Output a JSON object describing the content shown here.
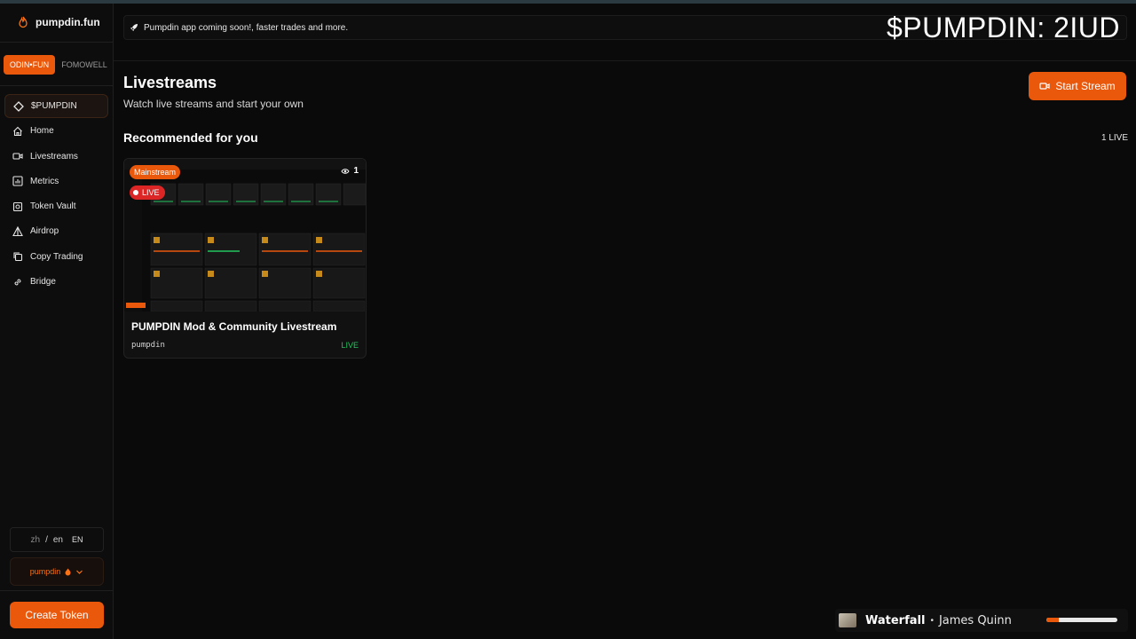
{
  "brand": {
    "name": "pumpdin.fun"
  },
  "platform": {
    "tabs": [
      "ODIN•FUN",
      "FOMOWELL"
    ],
    "active": 0
  },
  "nav": {
    "items": [
      {
        "label": "$PUMPDIN",
        "icon": "diamond-icon",
        "active": true
      },
      {
        "label": "Home",
        "icon": "home-icon"
      },
      {
        "label": "Livestreams",
        "icon": "video-icon"
      },
      {
        "label": "Metrics",
        "icon": "chart-icon"
      },
      {
        "label": "Token Vault",
        "icon": "vault-icon"
      },
      {
        "label": "Airdrop",
        "icon": "airdrop-icon"
      },
      {
        "label": "Copy Trading",
        "icon": "copy-icon"
      },
      {
        "label": "Bridge",
        "icon": "link-icon"
      }
    ]
  },
  "language": {
    "option_zh": "zh",
    "separator": "/",
    "option_en": "en",
    "current": "EN"
  },
  "account": {
    "name": "pumpdin"
  },
  "create_token": "Create Token",
  "banner": {
    "text": "Pumpdin app coming soon!, faster trades and more."
  },
  "overlay": {
    "ticker": "$PUMPDIN: 2IUD"
  },
  "page": {
    "title": "Livestreams",
    "subtitle": "Watch live streams and start your own",
    "start_stream": "Start Stream",
    "section_title": "Recommended for you",
    "live_count": "1 LIVE"
  },
  "stream_card": {
    "tag": "Mainstream",
    "live_badge": "LIVE",
    "viewers": "1",
    "title": "PUMPDIN Mod & Community Livestream",
    "user": "pumpdin",
    "status": "LIVE"
  },
  "player": {
    "track": "Waterfall",
    "bullet": "•",
    "artist": "James Quinn",
    "progress_fraction": 0.18
  },
  "colors": {
    "accent": "#ea580c",
    "live_red": "#dc2626",
    "live_green": "#22c55e"
  }
}
